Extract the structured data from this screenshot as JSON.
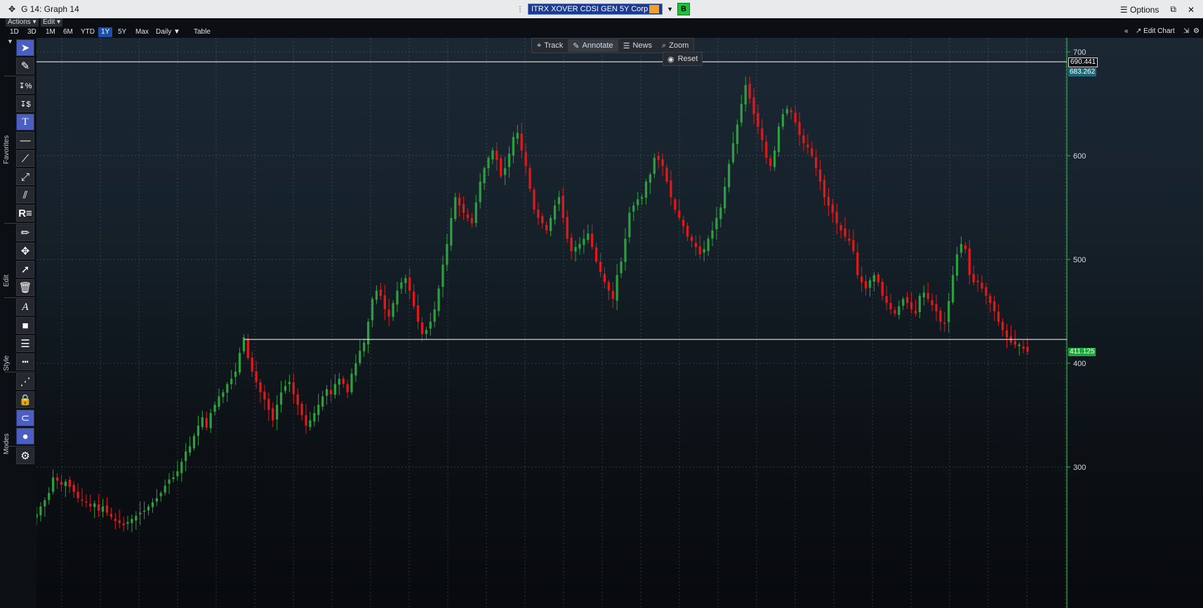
{
  "window": {
    "title": "G 14: Graph 14",
    "security": "ITRX XOVER CDSI GEN 5Y Corp",
    "b_button": "B",
    "options": "Options"
  },
  "menu": {
    "actions": "Actions",
    "edit": "Edit"
  },
  "periods": [
    "1D",
    "3D",
    "1M",
    "6M",
    "YTD",
    "1Y",
    "5Y",
    "Max"
  ],
  "active_period": "1Y",
  "frequency": "Daily",
  "table_label": "Table",
  "edit_chart": "Edit Chart",
  "toolbar_sections": {
    "favorites": "Favorites",
    "edit": "Edit",
    "style": "Style",
    "modes": "Modes"
  },
  "annotate_bar": {
    "track": "Track",
    "annotate": "Annotate",
    "news": "News",
    "zoom": "Zoom",
    "reset": "Reset"
  },
  "price_labels": {
    "high_line": "690.441",
    "high_close": "683.262",
    "last": "411.125"
  },
  "colors": {
    "up": "#2e9e3e",
    "down": "#e01a1a",
    "accent": "#1c4fa8",
    "axis_green": "#2ab24a"
  },
  "chart_data": {
    "type": "candlestick",
    "ylim": [
      230,
      710
    ],
    "yticks": [
      300,
      400,
      500,
      600,
      700
    ],
    "hlines": [
      690.441,
      423
    ],
    "last_value": 411.125,
    "series_close": [
      255,
      262,
      268,
      275,
      290,
      287,
      283,
      286,
      281,
      276,
      270,
      268,
      266,
      262,
      265,
      258,
      262,
      256,
      252,
      248,
      246,
      244,
      247,
      250,
      253,
      256,
      258,
      262,
      266,
      270,
      275,
      282,
      288,
      290,
      296,
      305,
      315,
      320,
      330,
      340,
      348,
      338,
      352,
      360,
      368,
      372,
      380,
      385,
      392,
      410,
      425,
      405,
      392,
      382,
      372,
      365,
      355,
      345,
      360,
      372,
      378,
      382,
      370,
      360,
      350,
      340,
      345,
      352,
      360,
      368,
      375,
      370,
      380,
      385,
      380,
      372,
      390,
      400,
      412,
      420,
      440,
      462,
      470,
      465,
      452,
      445,
      458,
      470,
      478,
      482,
      470,
      455,
      440,
      428,
      432,
      440,
      452,
      472,
      495,
      515,
      540,
      560,
      552,
      545,
      540,
      535,
      555,
      575,
      588,
      598,
      605,
      596,
      580,
      588,
      602,
      618,
      622,
      605,
      590,
      568,
      548,
      540,
      535,
      528,
      540,
      552,
      560,
      540,
      520,
      508,
      512,
      515,
      520,
      525,
      512,
      498,
      488,
      478,
      470,
      462,
      485,
      498,
      520,
      545,
      552,
      558,
      560,
      575,
      582,
      598,
      596,
      590,
      575,
      560,
      548,
      540,
      532,
      522,
      518,
      512,
      505,
      510,
      520,
      528,
      540,
      550,
      570,
      592,
      612,
      630,
      650,
      668,
      655,
      640,
      628,
      615,
      598,
      590,
      605,
      628,
      640,
      645,
      642,
      632,
      620,
      612,
      608,
      600,
      588,
      575,
      560,
      552,
      545,
      535,
      528,
      522,
      518,
      508,
      485,
      478,
      472,
      480,
      485,
      478,
      465,
      458,
      452,
      448,
      455,
      462,
      458,
      452,
      448,
      465,
      468,
      462,
      456,
      450,
      440,
      438,
      460,
      485,
      505,
      515,
      510,
      485,
      478,
      478,
      472,
      465,
      458,
      450,
      440,
      432,
      425,
      420,
      418,
      418,
      414,
      411
    ]
  }
}
